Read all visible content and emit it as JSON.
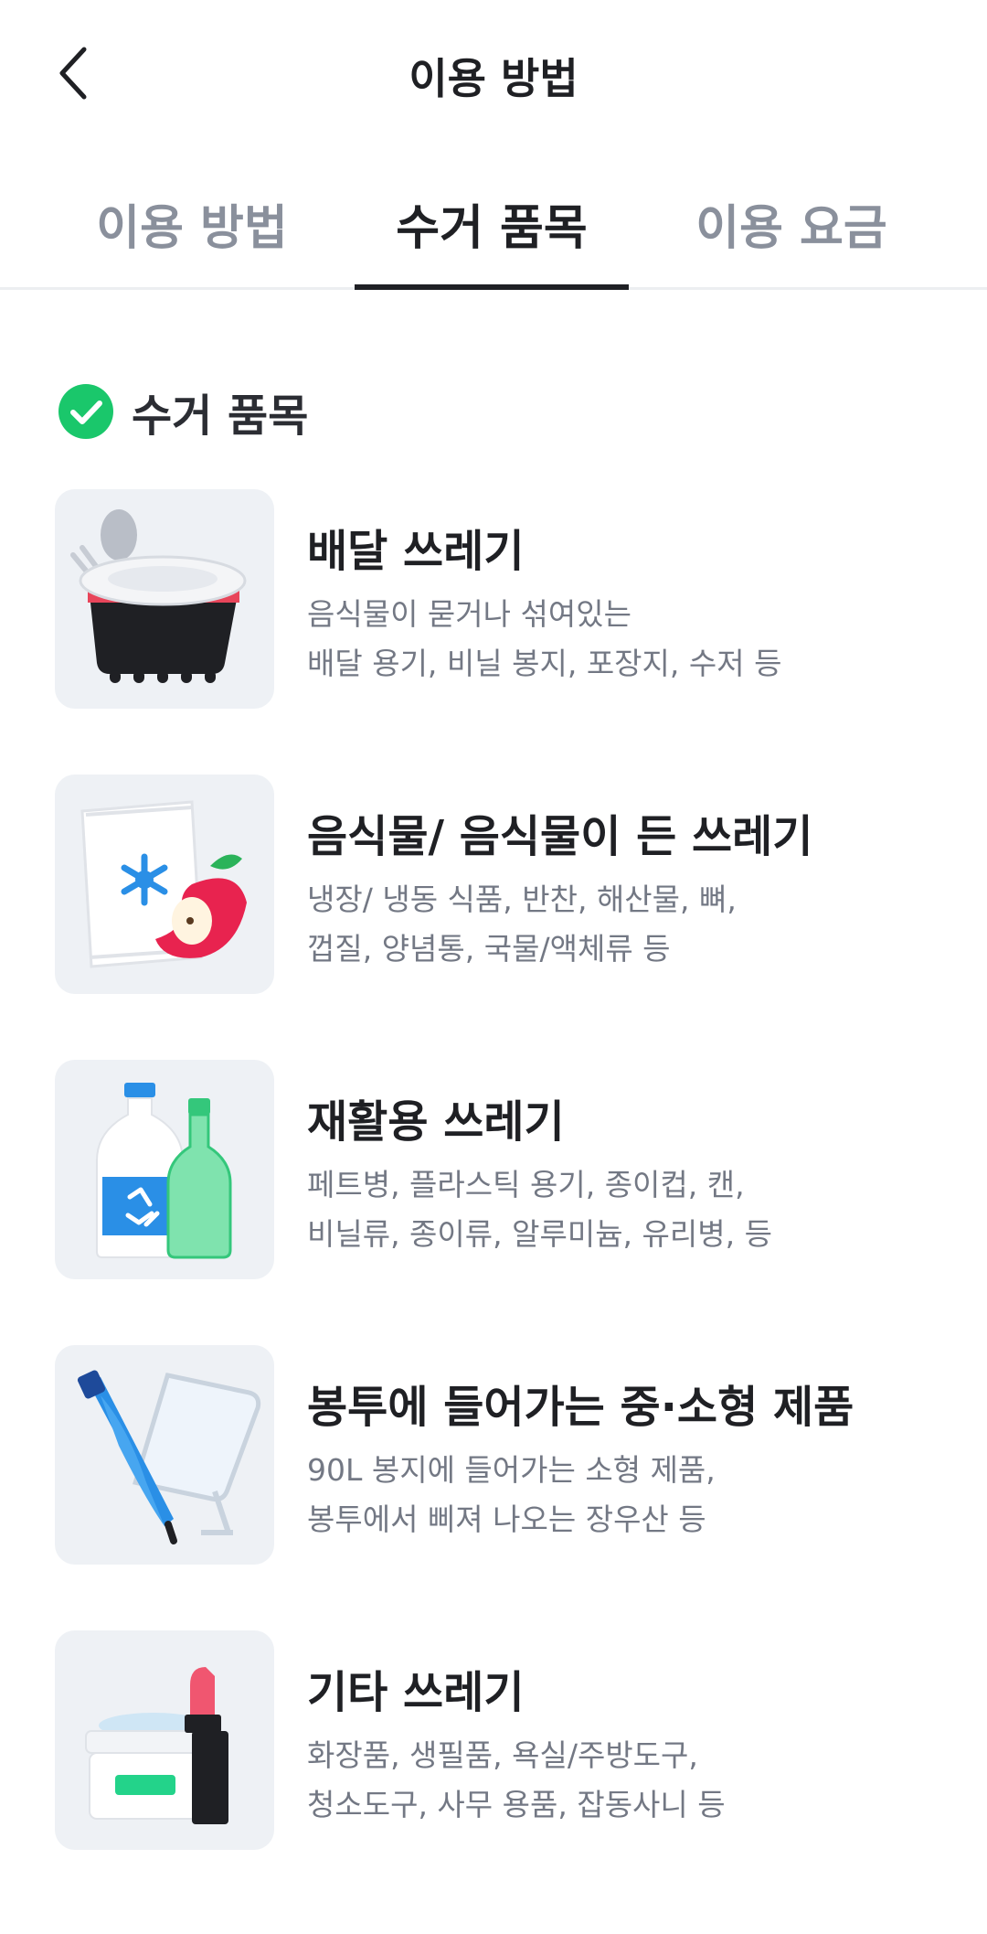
{
  "header": {
    "title": "이용 방법"
  },
  "tabs": [
    {
      "label": "이용 방법",
      "active": false
    },
    {
      "label": "수거 품목",
      "active": true
    },
    {
      "label": "이용 요금",
      "active": false
    }
  ],
  "section": {
    "title": "수거 품목",
    "check_color": "#1ac76b"
  },
  "items": [
    {
      "title": "배달 쓰레기",
      "desc_line1": "음식물이 묻거나 섞여있는",
      "desc_line2": "배달 용기, 비닐 봉지, 포장지, 수저 등",
      "icon": "delivery-container-icon"
    },
    {
      "title": "음식물/ 음식물이 든 쓰레기",
      "desc_line1": "냉장/ 냉동 식품, 반찬, 해산물, 뼈,",
      "desc_line2": "껍질, 양념통, 국물/액체류 등",
      "icon": "food-waste-icon"
    },
    {
      "title": "재활용 쓰레기",
      "desc_line1": "페트병, 플라스틱 용기, 종이컵, 캔,",
      "desc_line2": "비닐류, 종이류, 알루미늄, 유리병, 등",
      "icon": "recycling-bottles-icon"
    },
    {
      "title": "봉투에 들어가는 중·소형 제품",
      "desc_line1": "90L 봉지에 들어가는 소형 제품,",
      "desc_line2": "봉투에서 삐져 나오는 장우산 등",
      "icon": "umbrella-mirror-icon"
    },
    {
      "title": "기타 쓰레기",
      "desc_line1": "화장품, 생필품, 욕실/주방도구,",
      "desc_line2": "청소도구, 사무 용품, 잡동사니 등",
      "icon": "cosmetics-icon"
    }
  ]
}
